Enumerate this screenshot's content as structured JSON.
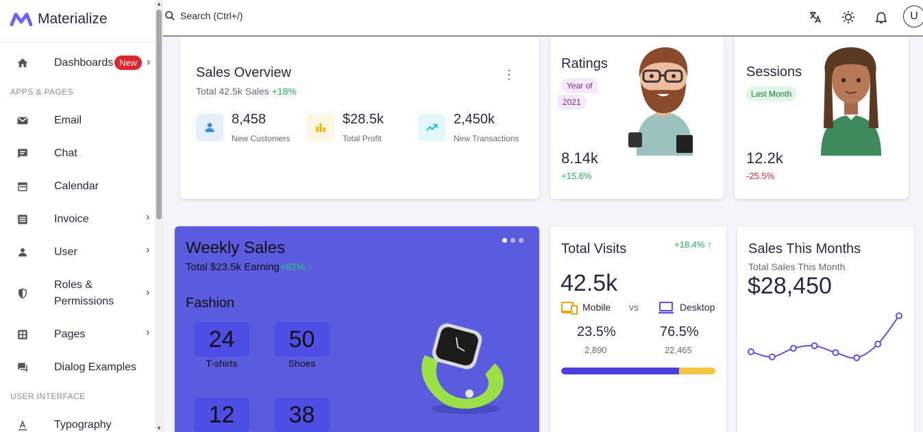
{
  "app": {
    "brand": "Materialize"
  },
  "sidebar": {
    "dashboards": {
      "label": "Dashboards",
      "badge": "New"
    },
    "sections": {
      "apps_pages": "APPS & PAGES",
      "user_interface": "USER INTERFACE"
    },
    "items": {
      "email": "Email",
      "chat": "Chat",
      "calendar": "Calendar",
      "invoice": "Invoice",
      "user": "User",
      "roles_1": "Roles &",
      "roles_2": "Permissions",
      "pages": "Pages",
      "dialog": "Dialog Examples",
      "typography": "Typography"
    }
  },
  "topbar": {
    "search_label": "Search (Ctrl+/)",
    "avatar_letter": "U"
  },
  "sales_overview": {
    "title": "Sales Overview",
    "subtitle": "Total 42.5k Sales",
    "growth": "+18%",
    "stats": [
      {
        "value": "8,458",
        "label": "New Customers"
      },
      {
        "value": "$28.5k",
        "label": "Total Profit"
      },
      {
        "value": "2,450k",
        "label": "New Transactions"
      }
    ]
  },
  "ratings": {
    "title": "Ratings",
    "chip_1": "Year of",
    "chip_2": "2021",
    "value": "8.14k",
    "change": "+15.6%"
  },
  "sessions": {
    "title": "Sessions",
    "chip": "Last Month",
    "value": "12.2k",
    "change": "-25.5%"
  },
  "weekly_sales": {
    "title": "Weekly Sales",
    "subtitle": "Total $23.5k Earning",
    "growth": "+62% ↑",
    "category": "Fashion",
    "items": [
      {
        "value": "24",
        "label": "T-shirts"
      },
      {
        "value": "50",
        "label": "Shoes"
      },
      {
        "value": "12",
        "label": ""
      },
      {
        "value": "38",
        "label": ""
      }
    ]
  },
  "total_visits": {
    "title": "Total Visits",
    "growth": "+18.4% ↑",
    "value": "42.5k",
    "mobile_label": "Mobile",
    "vs": "vs",
    "desktop_label": "Desktop",
    "mobile_pct": "23.5%",
    "mobile_count": "2,890",
    "desktop_pct": "76.5%",
    "desktop_count": "22,465",
    "desktop_share": 0.765
  },
  "sales_month": {
    "title": "Sales This Months",
    "subtitle": "Total Sales This Month",
    "value": "$28,450"
  },
  "chart_data": {
    "type": "line",
    "title": "",
    "xlabel": "",
    "ylabel": "",
    "x": [
      1,
      2,
      3,
      4,
      5,
      6,
      7,
      8
    ],
    "values": [
      28,
      22,
      32,
      35,
      27,
      21,
      37,
      70
    ],
    "ylim": [
      0,
      80
    ],
    "grid": false,
    "color": "#5b4fe6"
  },
  "colors": {
    "primary": "#5b5bdf",
    "success": "#22b55c",
    "error": "#e0252d",
    "warning": "#f5c542"
  }
}
